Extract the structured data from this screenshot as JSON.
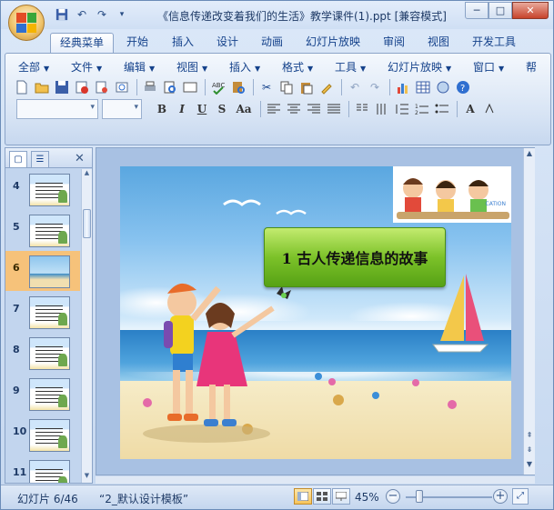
{
  "window": {
    "title": "《信息传递改变着我们的生活》教学课件(1).ppt [兼容模式]",
    "min_symbol": "─",
    "max_symbol": "□",
    "close_symbol": "✕"
  },
  "quick_access": [
    "save-icon",
    "undo-icon",
    "redo-icon",
    "customize-icon"
  ],
  "tabs": [
    "经典菜单",
    "开始",
    "插入",
    "设计",
    "动画",
    "幻灯片放映",
    "审阅",
    "视图",
    "开发工具"
  ],
  "active_tab": "经典菜单",
  "classic_menu": [
    "全部",
    "文件",
    "编辑",
    "视图",
    "插入",
    "格式",
    "工具",
    "幻灯片放映",
    "窗口",
    "帮"
  ],
  "format_buttons": {
    "bold": "B",
    "italic": "I",
    "underline": "U",
    "strike": "S",
    "case": "Aa",
    "font_color": "A"
  },
  "panel_tabs": [
    "slides-tab",
    "outline-tab"
  ],
  "panel_close": "✕",
  "thumbnails": [
    {
      "num": "4",
      "selected": false
    },
    {
      "num": "5",
      "selected": false
    },
    {
      "num": "6",
      "selected": true
    },
    {
      "num": "7",
      "selected": false
    },
    {
      "num": "8",
      "selected": false
    },
    {
      "num": "9",
      "selected": false
    },
    {
      "num": "10",
      "selected": false
    },
    {
      "num": "11",
      "selected": false
    }
  ],
  "slide": {
    "title": "1 古人传递信息的故事",
    "kids_caption": "CATION"
  },
  "status": {
    "slide_info": "幻灯片 6/46",
    "template": "“2_默认设计模板”",
    "zoom": "45%",
    "zoom_level_fraction": 0.45
  },
  "accent_colors": {
    "title_bar": "#dbe8f8",
    "selected_thumb": "#f6c27a",
    "title_box": "#7cc229"
  }
}
